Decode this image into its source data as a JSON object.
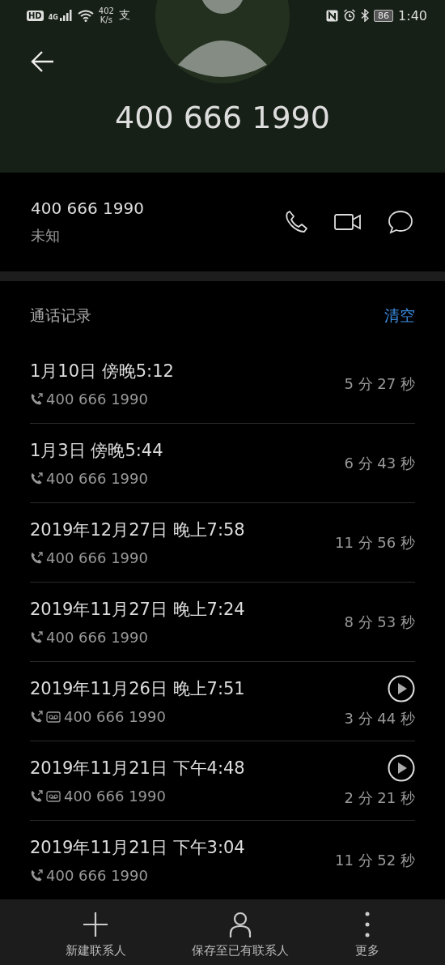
{
  "status_bar": {
    "hd": "HD",
    "network": "4G",
    "speed_value": "402",
    "speed_unit": "K/s",
    "app_glyph": "支",
    "battery": "86",
    "time": "1:40"
  },
  "header": {
    "title": "400 666 1990"
  },
  "contact": {
    "number": "400 666 1990",
    "label": "未知"
  },
  "call_log": {
    "title": "通话记录",
    "clear": "清空",
    "entries": [
      {
        "kind": "call",
        "date": "1月10日 傍晚5:12",
        "number": "400 666 1990",
        "duration": "5 分 27 秒"
      },
      {
        "kind": "call",
        "date": "1月3日 傍晚5:44",
        "number": "400 666 1990",
        "duration": "6 分 43 秒"
      },
      {
        "kind": "call",
        "date": "2019年12月27日 晚上7:58",
        "number": "400 666 1990",
        "duration": "11 分 56 秒"
      },
      {
        "kind": "call",
        "date": "2019年11月27日 晚上7:24",
        "number": "400 666 1990",
        "duration": "8 分 53 秒"
      },
      {
        "kind": "voicemail",
        "date": "2019年11月26日 晚上7:51",
        "number": "400 666 1990",
        "duration": "3 分 44 秒"
      },
      {
        "kind": "voicemail",
        "date": "2019年11月21日 下午4:48",
        "number": "400 666 1990",
        "duration": "2 分 21 秒"
      },
      {
        "kind": "call",
        "date": "2019年11月21日 下午3:04",
        "number": "400 666 1990",
        "duration": "11 分 52 秒"
      }
    ]
  },
  "bottom_bar": [
    {
      "kind": "add",
      "label": "新建联系人"
    },
    {
      "kind": "person",
      "label": "保存至已有联系人"
    },
    {
      "kind": "more",
      "label": "更多"
    }
  ]
}
